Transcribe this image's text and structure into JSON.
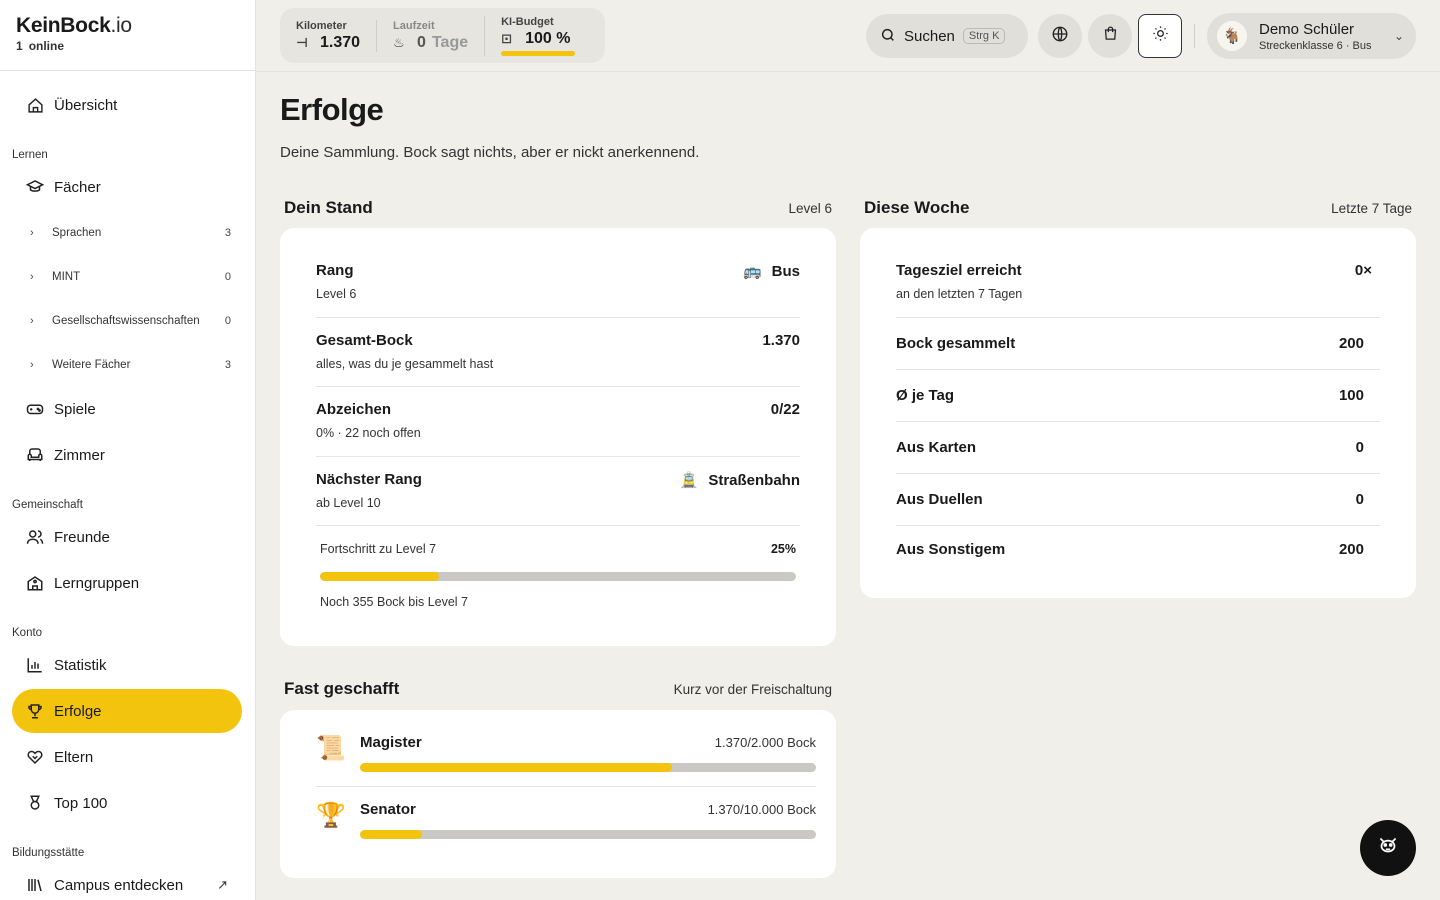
{
  "brand": {
    "name": "KeinBock",
    "tld": ".io",
    "online_count": "1",
    "online_label": "online"
  },
  "sidebar": {
    "overview": "Übersicht",
    "sections": {
      "learn": "Lernen",
      "community": "Gemeinschaft",
      "account": "Konto",
      "school": "Bildungsstätte"
    },
    "subjects": "Fächer",
    "sub_items": [
      {
        "label": "Sprachen",
        "count": "3"
      },
      {
        "label": "MINT",
        "count": "0"
      },
      {
        "label": "Gesellschaftswissenschaften",
        "count": "0"
      },
      {
        "label": "Weitere Fächer",
        "count": "3"
      }
    ],
    "games": "Spiele",
    "room": "Zimmer",
    "friends": "Freunde",
    "groups": "Lerngruppen",
    "stats": "Statistik",
    "achievements": "Erfolge",
    "parents": "Eltern",
    "top100": "Top 100",
    "campus": "Campus entdecken"
  },
  "header": {
    "km_label": "Kilometer",
    "km_value": "1.370",
    "runtime_label": "Laufzeit",
    "runtime_value": "0",
    "runtime_unit": "Tage",
    "budget_label": "KI-Budget",
    "budget_value": "100 %",
    "budget_fraction": 1.0,
    "search_label": "Suchen",
    "search_shortcut": "Strg K",
    "user_name": "Demo Schüler",
    "user_sub": "Streckenklasse 6 · Bus"
  },
  "page": {
    "title": "Erfolge",
    "subtitle": "Deine Sammlung. Bock sagt nichts, aber er nickt anerkennend."
  },
  "stand": {
    "title": "Dein Stand",
    "meta": "Level 6",
    "rows": [
      {
        "title": "Rang",
        "sub": "Level 6",
        "value": "Bus",
        "emoji": "🚌"
      },
      {
        "title": "Gesamt-Bock",
        "sub": "alles, was du je gesammelt hast",
        "value": "1.370",
        "emoji": ""
      },
      {
        "title": "Abzeichen",
        "sub": "0% · 22 noch offen",
        "value": "0/22",
        "emoji": ""
      },
      {
        "title": "Nächster Rang",
        "sub": "ab Level 10",
        "value": "Straßenbahn",
        "emoji": "🚊"
      }
    ],
    "progress_label": "Fortschritt zu Level 7",
    "progress_pct": "25%",
    "progress_fraction": 0.25,
    "progress_note": "Noch 355 Bock bis Level 7"
  },
  "week": {
    "title": "Diese Woche",
    "meta": "Letzte 7 Tage",
    "rows": [
      {
        "title": "Tagesziel erreicht",
        "sub": "an den letzten 7 Tagen",
        "value": "0×"
      },
      {
        "title": "Bock gesammelt",
        "sub": "",
        "value": "200"
      },
      {
        "title": "Ø je Tag",
        "sub": "",
        "value": "100"
      },
      {
        "title": "Aus Karten",
        "sub": "",
        "value": "0"
      },
      {
        "title": "Aus Duellen",
        "sub": "",
        "value": "0"
      },
      {
        "title": "Aus Sonstigem",
        "sub": "",
        "value": "200"
      }
    ]
  },
  "almost": {
    "title": "Fast geschafft",
    "meta": "Kurz vor der Freischaltung",
    "items": [
      {
        "name": "Magister",
        "value": "1.370/2.000 Bock",
        "fraction": 0.685,
        "icon": "📜"
      },
      {
        "name": "Senator",
        "value": "1.370/10.000 Bock",
        "fraction": 0.137,
        "icon": "🏆"
      }
    ]
  },
  "colors": {
    "accent": "#f3c40e",
    "background": "#f0efea",
    "card": "#ffffff"
  }
}
